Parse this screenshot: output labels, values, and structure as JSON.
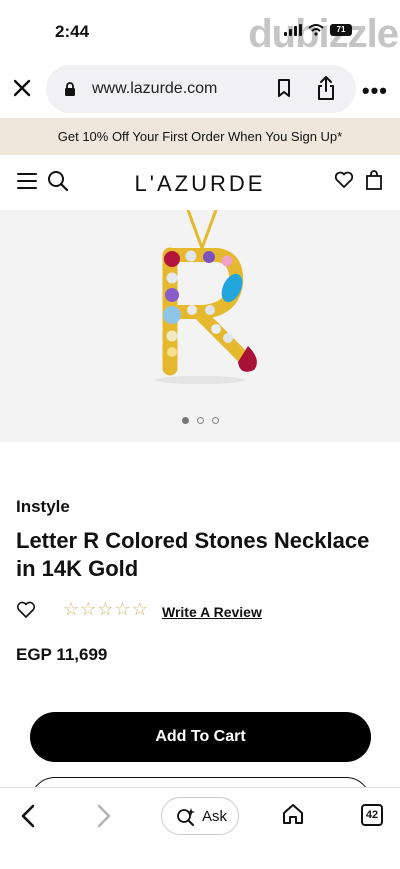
{
  "status_bar": {
    "time": "2:44",
    "battery": "71",
    "watermark": "dubizzle"
  },
  "browser": {
    "url": "www.lazurde.com"
  },
  "promo": {
    "text": "Get 10% Off Your First Order When You Sign Up*"
  },
  "header": {
    "logo": "L'AZURDE"
  },
  "product": {
    "brand": "Instyle",
    "title": "Letter R Colored Stones Necklace in 14K Gold",
    "review_label": "Write A Review",
    "rating": 0,
    "rating_max": 5,
    "price": "EGP 11,699",
    "gallery_page": 1,
    "gallery_total": 3
  },
  "actions": {
    "add_to_cart": "Add To Cart"
  },
  "bottom_nav": {
    "ask_label": "Ask",
    "tab_count": "42"
  },
  "colors": {
    "promo_bg": "#efe7db",
    "star": "#d2b471",
    "gold": "#e6b82e"
  }
}
